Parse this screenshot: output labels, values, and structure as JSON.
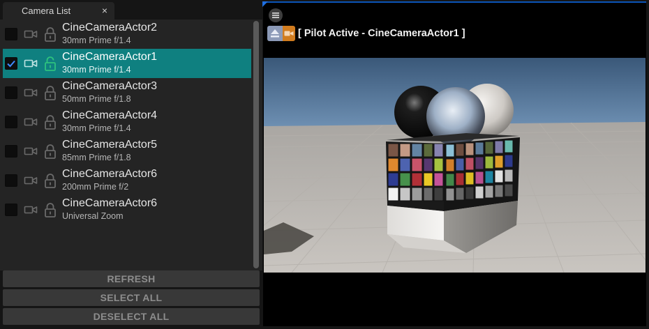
{
  "panel": {
    "tab_title": "Camera List",
    "close_glyph": "×",
    "cameras": [
      {
        "name": "CineCameraActor2",
        "lens": "30mm Prime f/1.4",
        "checked": false,
        "locked": true
      },
      {
        "name": "CineCameraActor1",
        "lens": "30mm Prime f/1.4",
        "checked": true,
        "locked": false
      },
      {
        "name": "CineCameraActor3",
        "lens": "50mm Prime f/1.8",
        "checked": false,
        "locked": true
      },
      {
        "name": "CineCameraActor4",
        "lens": "30mm Prime f/1.4",
        "checked": false,
        "locked": true
      },
      {
        "name": "CineCameraActor5",
        "lens": "85mm Prime f/1.8",
        "checked": false,
        "locked": true
      },
      {
        "name": "CineCameraActor6",
        "lens": "200mm Prime f/2",
        "checked": false,
        "locked": true
      },
      {
        "name": "CineCameraActor6",
        "lens": "Universal Zoom",
        "checked": false,
        "locked": true
      }
    ],
    "buttons": {
      "refresh": "REFRESH",
      "select_all": "SELECT ALL",
      "deselect_all": "DESELECT ALL"
    }
  },
  "viewport": {
    "pilot_label": "[ Pilot Active - CineCameraActor1 ]",
    "menu_icon": "hamburger-icon",
    "eject_icon": "eject-icon",
    "pilot_camera_icon": "video-camera-icon"
  },
  "colors": {
    "selection": "#0f8080",
    "unlocked_lock": "#2ec27e",
    "pilot_orange": "#d17c1f",
    "viewport_accent": "#0b54b8"
  }
}
